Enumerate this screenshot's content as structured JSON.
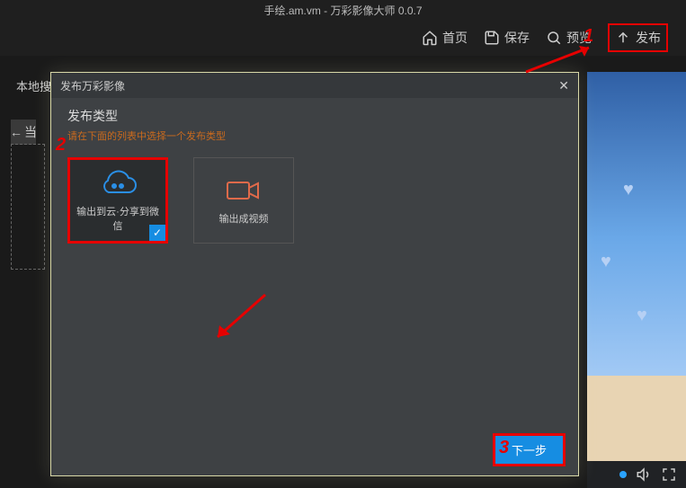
{
  "app": {
    "title": "手绘.am.vm - 万彩影像大师 0.0.7"
  },
  "toolbar": {
    "home": "首页",
    "save": "保存",
    "preview": "预览",
    "publish": "发布"
  },
  "left": {
    "search": "本地搜",
    "back": "当"
  },
  "modal": {
    "title": "发布万彩影像",
    "section": "发布类型",
    "hint": "请在下面的列表中选择一个发布类型",
    "opt_cloud": "输出到云·分享到微信",
    "opt_video": "输出成视频",
    "next": "下一步"
  },
  "annot": {
    "one": "1",
    "two": "2",
    "three": "3"
  }
}
